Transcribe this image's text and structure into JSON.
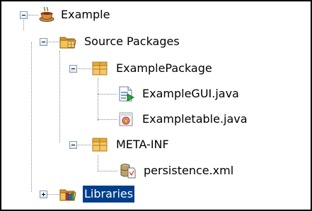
{
  "tree": {
    "root": {
      "label": "Example",
      "expanded": true,
      "icon": "coffee-cup-project-icon"
    },
    "source_packages": {
      "label": "Source Packages",
      "expanded": true,
      "icon": "folder-packages-icon"
    },
    "example_package": {
      "label": "ExamplePackage",
      "expanded": true,
      "icon": "package-icon"
    },
    "example_gui": {
      "label": "ExampleGUI.java",
      "icon": "java-form-icon"
    },
    "example_table": {
      "label": "Exampletable.java",
      "icon": "java-class-icon"
    },
    "meta_inf": {
      "label": "META-INF",
      "expanded": true,
      "icon": "package-icon"
    },
    "persistence": {
      "label": "persistence.xml",
      "icon": "persistence-xml-icon"
    },
    "libraries": {
      "label": "Libraries",
      "expanded": false,
      "selected": true,
      "icon": "libraries-folder-icon"
    }
  },
  "colors": {
    "selection": "#003e8c",
    "package_icon": "#f2b233",
    "folder_icon": "#e9b94c",
    "tree_lines": "#8a8a8a"
  }
}
